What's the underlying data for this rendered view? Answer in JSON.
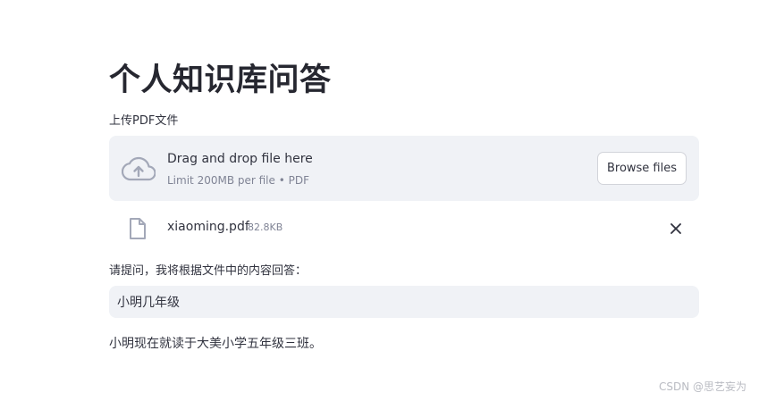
{
  "page": {
    "title": "个人知识库问答"
  },
  "uploader": {
    "label": "上传PDF文件",
    "drag_text": "Drag and drop file here",
    "limit_text": "Limit 200MB per file • PDF",
    "browse_label": "Browse files",
    "upload_icon": "cloud-upload-icon"
  },
  "uploaded_file": {
    "name": "xiaoming.pdf",
    "size": "82.8KB",
    "file_icon": "file-icon",
    "remove_icon": "close-icon"
  },
  "question": {
    "label": "请提问，我将根据文件中的内容回答：",
    "value": "小明几年级"
  },
  "answer": {
    "text": "小明现在就读于大美小学五年级三班。"
  },
  "watermark": {
    "text": "CSDN @思艺妄为"
  },
  "colors": {
    "text": "#31333f",
    "muted": "#808495",
    "surface": "#f0f2f6",
    "icon": "#a3a8b8"
  }
}
